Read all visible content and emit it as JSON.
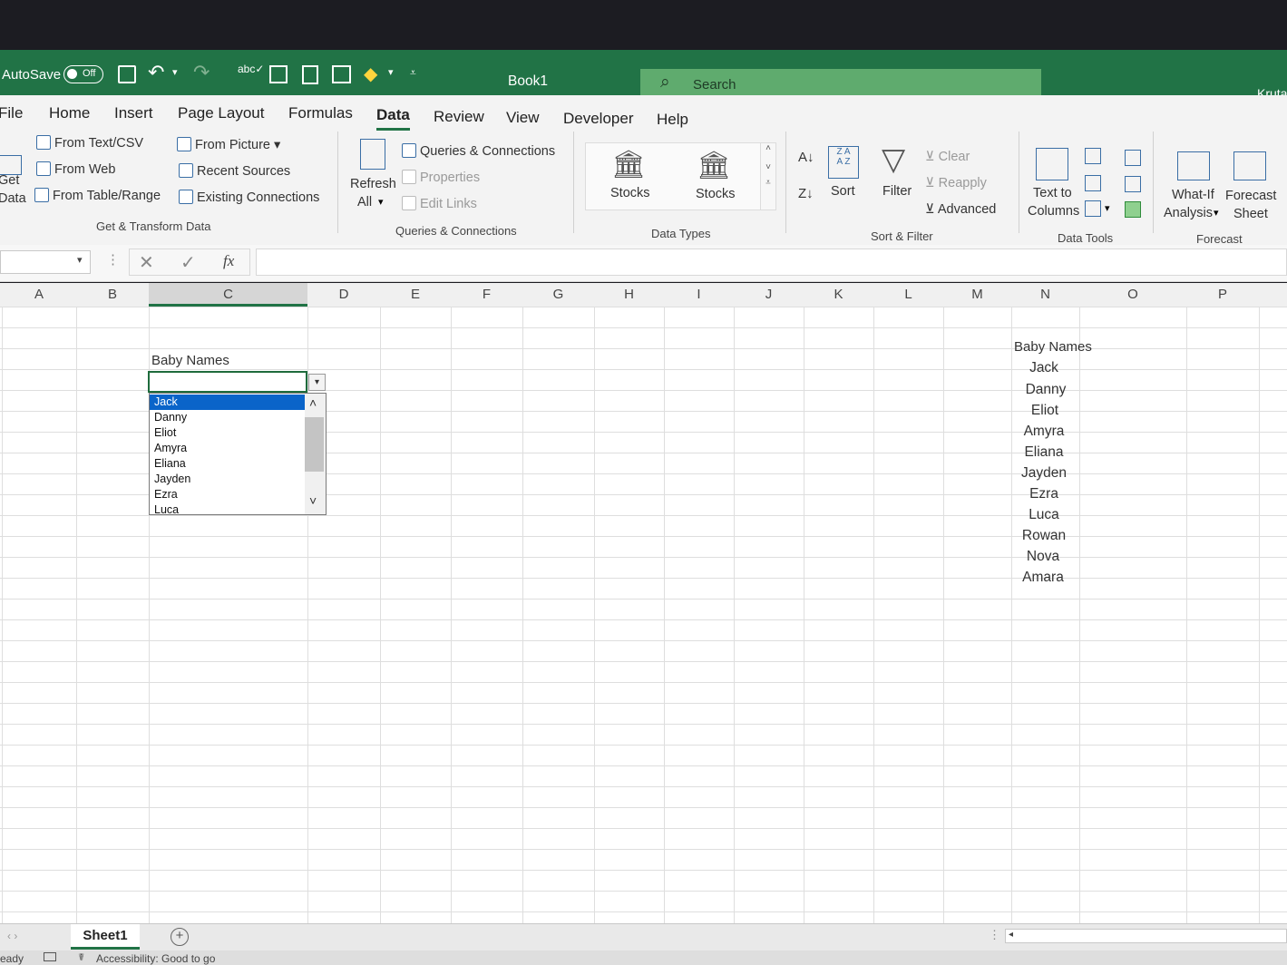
{
  "titlebar": {
    "autosave_label": "AutoSave",
    "autosave_state": "Off",
    "book_title": "Book1",
    "search_placeholder": "Search",
    "user": "Kruta"
  },
  "tabs": [
    "File",
    "Home",
    "Insert",
    "Page Layout",
    "Formulas",
    "Data",
    "Review",
    "View",
    "Developer",
    "Help"
  ],
  "active_tab": "Data",
  "ribbon": {
    "get_data": [
      "Get",
      "Data"
    ],
    "get_transform": {
      "from_text_csv": "From Text/CSV",
      "from_web": "From Web",
      "from_table": "From Table/Range",
      "from_picture": "From Picture",
      "recent_sources": "Recent Sources",
      "existing_connections": "Existing Connections",
      "group": "Get & Transform Data"
    },
    "queries": {
      "refresh": "Refresh",
      "refresh_all": "All",
      "queries_connections": "Queries & Connections",
      "properties": "Properties",
      "edit_links": "Edit Links",
      "group": "Queries & Connections"
    },
    "data_types": {
      "stocks1": "Stocks",
      "stocks2": "Stocks",
      "group": "Data Types"
    },
    "sort_filter": {
      "sort": "Sort",
      "filter": "Filter",
      "clear": "Clear",
      "reapply": "Reapply",
      "advanced": "Advanced",
      "group": "Sort & Filter"
    },
    "data_tools": {
      "text_to_columns_1": "Text to",
      "text_to_columns_2": "Columns",
      "group": "Data Tools"
    },
    "forecast": {
      "whatif_1": "What-If",
      "whatif_2": "Analysis",
      "forecast_1": "Forecast",
      "forecast_2": "Sheet",
      "group": "Forecast"
    }
  },
  "formula_bar": {
    "fx": "fx",
    "content": ""
  },
  "columns": [
    "A",
    "B",
    "C",
    "D",
    "E",
    "F",
    "G",
    "H",
    "I",
    "J",
    "K",
    "L",
    "M",
    "N",
    "O",
    "P"
  ],
  "selected_column": "C",
  "cells": {
    "c_header": "Baby Names",
    "n_header": "Baby Names",
    "n_values": [
      "Jack",
      "Danny",
      "Eliot",
      "Amyra",
      "Eliana",
      "Jayden",
      "Ezra",
      "Luca",
      "Rowan",
      "Nova",
      "Amara"
    ]
  },
  "dropdown": {
    "options": [
      "Jack",
      "Danny",
      "Eliot",
      "Amyra",
      "Eliana",
      "Jayden",
      "Ezra",
      "Luca"
    ],
    "selected": "Jack"
  },
  "sheets": {
    "active": "Sheet1",
    "add_label": "+"
  },
  "status": {
    "ready": "eady",
    "accessibility": "Accessibility: Good to go"
  }
}
